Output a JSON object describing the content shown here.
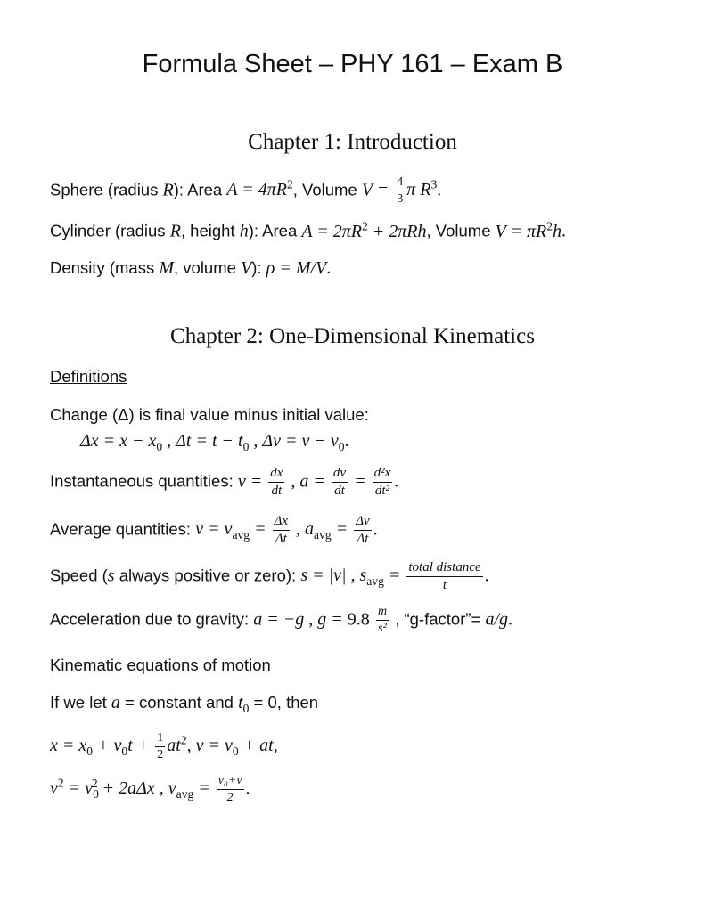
{
  "title": "Formula Sheet – PHY 161 – Exam B",
  "chapter1": {
    "heading": "Chapter 1: Introduction",
    "sphere": {
      "label": "Sphere (radius ",
      "var": "R",
      "mid": "): Area ",
      "area": "A = 4πR",
      "area_exp": "2",
      "vol_label": ", Volume ",
      "vol_lhs": "V = ",
      "frac_num": "4",
      "frac_den": "3",
      "vol_rhs": "π R",
      "vol_exp": "3",
      "end": "."
    },
    "cylinder": {
      "label": "Cylinder (radius ",
      "var_r": "R",
      "sep": ", height ",
      "var_h": "h",
      "mid": "): Area ",
      "area_a": "A = 2πR",
      "area_exp": "2",
      "area_b": " + 2πRh",
      "vol_label": ", Volume ",
      "vol_a": "V = πR",
      "vol_exp": "2",
      "vol_b": "h",
      "end": "."
    },
    "density": {
      "label": "Density (mass ",
      "var_m": "M",
      "sep": ", volume ",
      "var_v": "V",
      "mid": "): ",
      "formula": "ρ = M/V",
      "end": "."
    }
  },
  "chapter2": {
    "heading": "Chapter 2: One-Dimensional Kinematics",
    "definitions_heading": "Definitions",
    "change_text": "Change (Δ) is final value minus initial value:",
    "change_formula": {
      "a": "Δx = x − x",
      "a_sub": "0",
      "b": " , Δt = t − t",
      "b_sub": "0",
      "c": " , Δv = v − v",
      "c_sub": "0",
      "end": "."
    },
    "instantaneous": {
      "label": "Instantaneous quantities:  ",
      "v_lhs": "v = ",
      "v_num": "dx",
      "v_den": "dt",
      "sep": " ,  ",
      "a_lhs": "a = ",
      "a_num": "dv",
      "a_den": "dt",
      "eq": " = ",
      "a2_num": "d²x",
      "a2_den": "dt²",
      "end": "."
    },
    "average": {
      "label": "Average quantities:  ",
      "lhs": "v̄ = v",
      "lhs_sub": "avg",
      "eq": " = ",
      "v_num": "Δx",
      "v_den": "Δt",
      "sep": " , a",
      "a_sub": "avg",
      "eq2": " = ",
      "a_num": "Δv",
      "a_den": "Δt",
      "end": "."
    },
    "speed": {
      "label": "Speed (",
      "var": "s",
      "label2": " always positive or zero):  ",
      "f1": "s = |v| , s",
      "f1_sub": "avg",
      "eq": " = ",
      "num": "total distance",
      "den": "t",
      "end": "."
    },
    "gravity": {
      "label": "Acceleration due to gravity:  ",
      "f1": "a = −g ,  g = ",
      "value": "9.8",
      "unit_num": "m",
      "unit_den": "s²",
      "label2": " , “g-factor”= ",
      "f2": "a/g",
      "end": "."
    },
    "kinematic_heading": "Kinematic equations of motion",
    "condition": {
      "a": "If we let ",
      "var_a": "a",
      "b": " = constant and ",
      "var_t": "t",
      "t_sub": "0",
      "c": " = 0, then"
    },
    "eq1": {
      "a": "x = x",
      "a_sub": "0",
      "b": " + v",
      "b_sub": "0",
      "c": "t + ",
      "frac_num": "1",
      "frac_den": "2",
      "d": "at",
      "d_exp": "2",
      "e": ",  v = v",
      "e_sub": "0",
      "f": " + at,"
    },
    "eq2": {
      "a": "v",
      "a_exp": "2",
      "b": " = v",
      "b_sub": "0",
      "b_exp": "2",
      "c": " + 2aΔx ,  v",
      "c_sub": "avg",
      "eq": " = ",
      "num": "v₀+v",
      "den": "2",
      "end": "."
    }
  }
}
